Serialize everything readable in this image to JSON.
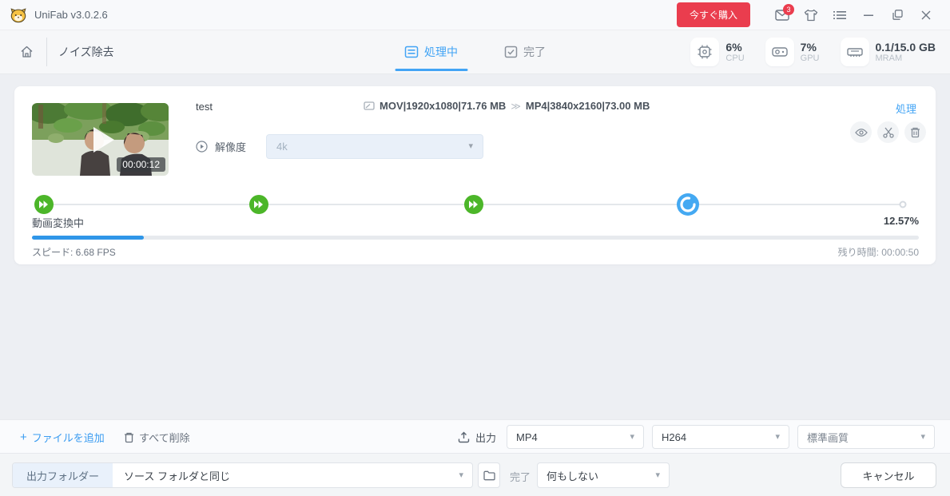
{
  "titlebar": {
    "app_title": "UniFab v3.0.2.6",
    "buy_button": "今すぐ購入",
    "mail_badge": "3"
  },
  "toolbar": {
    "module_name": "ノイズ除去",
    "tabs": [
      {
        "label": "処理中",
        "active": true
      },
      {
        "label": "完了",
        "active": false
      }
    ],
    "stats": [
      {
        "value": "6%",
        "label": "CPU"
      },
      {
        "value": "7%",
        "label": "GPU"
      },
      {
        "value": "0.1/15.0 GB",
        "label": "MRAM"
      }
    ]
  },
  "task": {
    "filename": "test",
    "duration": "00:00:12",
    "source_info": "MOV|1920x1080|71.76 MB",
    "target_info": "MP4|3840x2160|73.00 MB",
    "process_link": "処理",
    "resolution_label": "解像度",
    "resolution_value": "4k",
    "status_text": "動画変換中",
    "progress_percent": "12.57%",
    "progress_value": 12.57,
    "speed_text": "スピード: 6.68  FPS",
    "remaining_text": "残り時間: 00:00:50",
    "stages": [
      {
        "pos": 0,
        "state": "done"
      },
      {
        "pos": 25,
        "state": "done"
      },
      {
        "pos": 50,
        "state": "done"
      },
      {
        "pos": 75,
        "state": "current"
      },
      {
        "pos": 100,
        "state": "pending"
      }
    ]
  },
  "footer": {
    "add_files": "ファイルを追加",
    "delete_all": "すべて削除",
    "output_label": "出力",
    "format_value": "MP4",
    "codec_value": "H264",
    "quality_value": "標準画質"
  },
  "bottombar": {
    "output_folder_label": "出力フォルダー",
    "output_folder_value": "ソース フォルダと同じ",
    "on_complete_label": "完了",
    "on_complete_value": "何もしない",
    "cancel_button": "キャンセル"
  },
  "icons": {
    "dropdown_arrow": "▾",
    "transition_arrow": "≫",
    "plus": "+"
  },
  "colors": {
    "accent_blue": "#42a4f5",
    "buy_red": "#ea3d4e",
    "stage_green": "#4cb629",
    "progress_blue": "#2f96e8"
  }
}
